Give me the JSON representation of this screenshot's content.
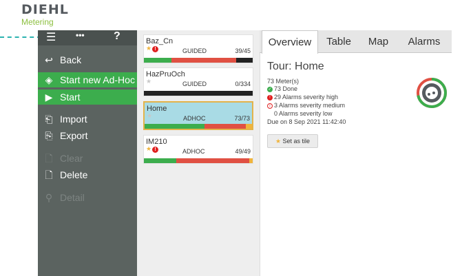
{
  "header": {
    "logo": "DIEHL",
    "logo_sub": "Metering"
  },
  "sidebar": {
    "top_icons": [
      "☰",
      "•••",
      "?"
    ],
    "items": [
      {
        "label": "Back",
        "icon": "back-arrow-icon"
      },
      {
        "label": "Start new Ad-Hoc",
        "icon": "start-adhoc-icon"
      },
      {
        "label": "Start",
        "icon": "play-icon"
      },
      {
        "label": "Import",
        "icon": "import-icon"
      },
      {
        "label": "Export",
        "icon": "export-icon"
      },
      {
        "label": "Clear",
        "icon": "clear-icon"
      },
      {
        "label": "Delete",
        "icon": "delete-icon"
      },
      {
        "label": "Detail",
        "icon": "search-icon"
      }
    ]
  },
  "tours": [
    {
      "name": "Baz_Cn",
      "type": "GUIDED",
      "count": "39/45",
      "progress": [
        0.25,
        0.6,
        0.15
      ],
      "colors": [
        "#3cad4d",
        "#e05043",
        "#222222"
      ]
    },
    {
      "name": "HazPruOch",
      "type": "GUIDED",
      "count": "0/334",
      "progress": [
        1.0
      ],
      "colors": [
        "#222222"
      ]
    },
    {
      "name": "Home",
      "type": "ADHOC",
      "count": "73/73",
      "progress": [
        0.56,
        0.38,
        0.06
      ],
      "colors": [
        "#3cad4d",
        "#e05043",
        "#f0b43c"
      ]
    },
    {
      "name": "IM210",
      "type": "ADHOC",
      "count": "49/49",
      "progress": [
        0.3,
        0.67,
        0.03
      ],
      "colors": [
        "#3cad4d",
        "#e05043",
        "#f0b43c"
      ]
    }
  ],
  "tabs": [
    "Overview",
    "Table",
    "Map",
    "Alarms"
  ],
  "detail": {
    "title": "Tour: Home",
    "meters": "73 Meter(s)",
    "done": "73 Done",
    "alarms_high": "29 Alarms severity high",
    "alarms_medium": "3 Alarms severity medium",
    "alarms_low": "0 Alarms severity low",
    "due": "Due on 8 Sep 2021 11:42:40",
    "tile_button": "Set as tile",
    "gauge_fraction": 1.0
  },
  "colors": {
    "green": "#3cad4d",
    "red": "#e05043",
    "sidebar": "#5b6360",
    "accent": "#2bb3b0"
  }
}
